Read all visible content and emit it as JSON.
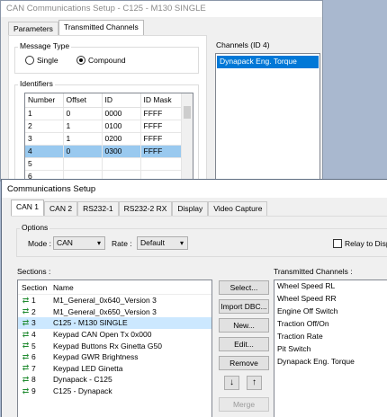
{
  "back_window": {
    "title": "CAN Communications Setup - C125 - M130 SINGLE",
    "tabs": [
      {
        "label": "Parameters",
        "active": false
      },
      {
        "label": "Transmitted Channels",
        "active": true
      }
    ],
    "message_type": {
      "label": "Message Type",
      "options": [
        {
          "label": "Single",
          "selected": false
        },
        {
          "label": "Compound",
          "selected": true
        }
      ]
    },
    "identifiers": {
      "label": "Identifiers",
      "columns": [
        "Number",
        "Offset",
        "ID",
        "ID Mask"
      ],
      "rows": [
        {
          "number": "1",
          "offset": "0",
          "id": "0000",
          "mask": "FFFF",
          "selected": false
        },
        {
          "number": "2",
          "offset": "1",
          "id": "0100",
          "mask": "FFFF",
          "selected": false
        },
        {
          "number": "3",
          "offset": "1",
          "id": "0200",
          "mask": "FFFF",
          "selected": false
        },
        {
          "number": "4",
          "offset": "0",
          "id": "0300",
          "mask": "FFFF",
          "selected": true
        },
        {
          "number": "5",
          "offset": "",
          "id": "",
          "mask": "",
          "selected": false
        },
        {
          "number": "6",
          "offset": "",
          "id": "",
          "mask": "",
          "selected": false
        }
      ]
    },
    "channels": {
      "label": "Channels (ID 4)",
      "items": [
        {
          "label": "Dynapack Eng. Torque",
          "selected": true
        }
      ]
    }
  },
  "front_window": {
    "title": "Communications Setup",
    "tabs": [
      {
        "label": "CAN 1",
        "active": true
      },
      {
        "label": "CAN 2",
        "active": false
      },
      {
        "label": "RS232-1",
        "active": false
      },
      {
        "label": "RS232-2 RX",
        "active": false
      },
      {
        "label": "Display",
        "active": false
      },
      {
        "label": "Video Capture",
        "active": false
      }
    ],
    "options": {
      "label": "Options",
      "mode_label": "Mode :",
      "mode_value": "CAN",
      "rate_label": "Rate :",
      "rate_value": "Default",
      "relay_label": "Relay to Displa",
      "relay_checked": false
    },
    "sections": {
      "label": "Sections :",
      "columns": [
        "Section",
        "Name"
      ],
      "rows": [
        {
          "num": "1",
          "name": "M1_General_0x640_Version 3",
          "selected": false
        },
        {
          "num": "2",
          "name": "M1_General_0x650_Version 3",
          "selected": false
        },
        {
          "num": "3",
          "name": "C125 - M130 SINGLE",
          "selected": true
        },
        {
          "num": "4",
          "name": "Keypad CAN Open Tx 0x000",
          "selected": false
        },
        {
          "num": "5",
          "name": "Keypad Buttons Rx Ginetta G50",
          "selected": false
        },
        {
          "num": "6",
          "name": "Keypad GWR Brightness",
          "selected": false
        },
        {
          "num": "7",
          "name": "Keypad LED Ginetta",
          "selected": false
        },
        {
          "num": "8",
          "name": "Dynapack - C125",
          "selected": false
        },
        {
          "num": "9",
          "name": "C125 - Dynapack",
          "selected": false
        }
      ],
      "icon": "exchange-arrows-icon"
    },
    "buttons": {
      "select": "Select...",
      "import": "Import DBC...",
      "new": "New...",
      "edit": "Edit...",
      "remove": "Remove",
      "move_down": "↓",
      "move_up": "↑",
      "merge": "Merge"
    },
    "transmitted": {
      "label": "Transmitted Channels :",
      "items": [
        "Wheel Speed RL",
        "Wheel Speed RR",
        "Engine Off Switch",
        "Traction Off/On",
        "Traction Rate",
        "Pit Switch",
        "Dynapack Eng. Torque"
      ]
    }
  }
}
